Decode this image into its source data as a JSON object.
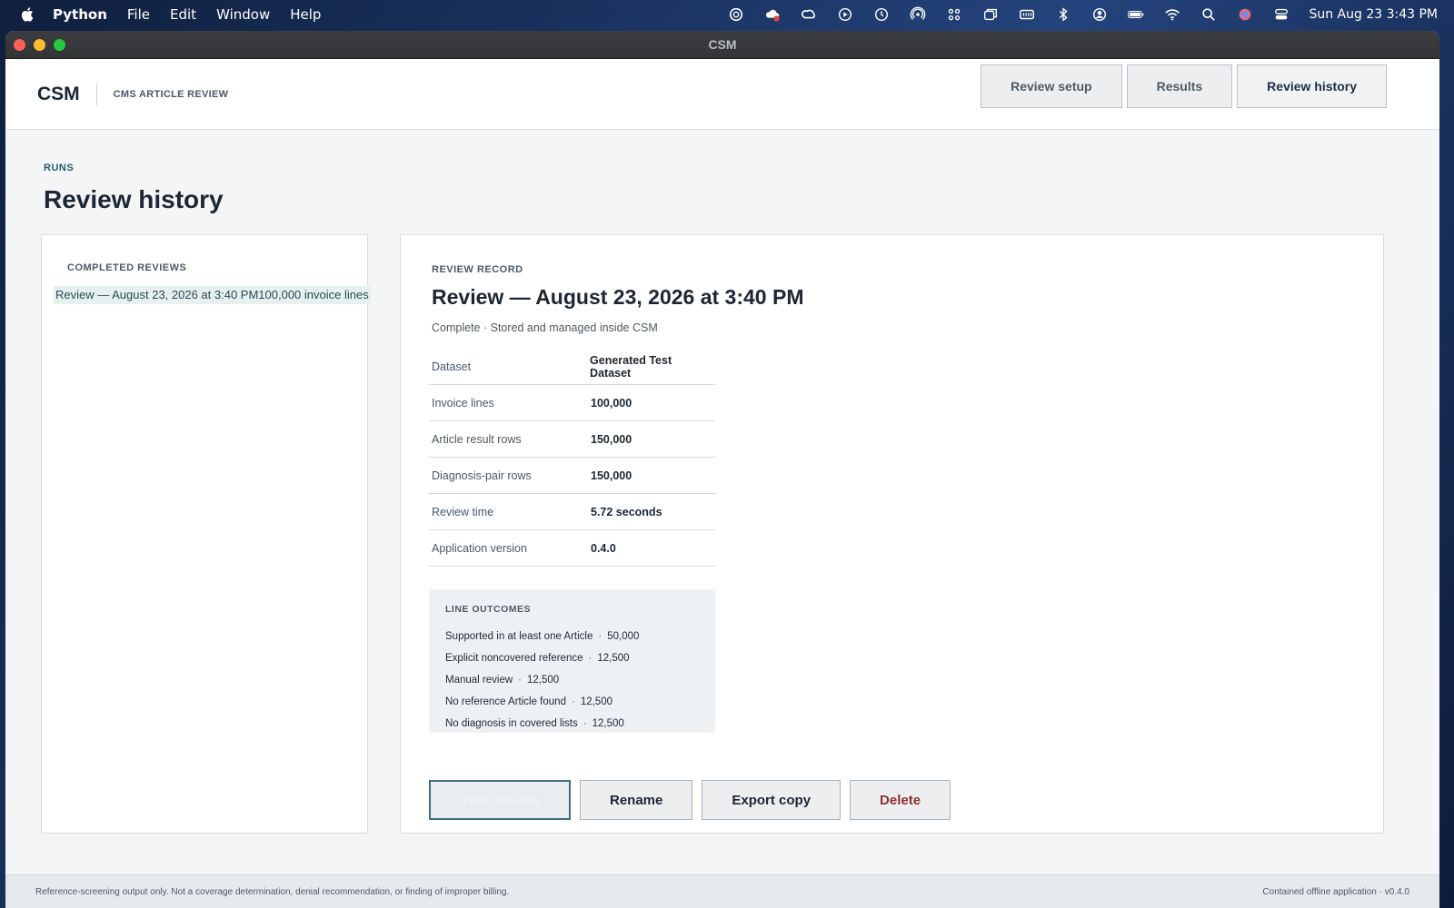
{
  "menubar": {
    "app_name": "Python",
    "items": [
      "File",
      "Edit",
      "Window",
      "Help"
    ],
    "clock": "Sun Aug 23  3:43 PM"
  },
  "window": {
    "title": "CSM"
  },
  "header": {
    "brand": "CSM",
    "subtitle": "CMS ARTICLE REVIEW",
    "nav": [
      {
        "label": "Review setup",
        "active": false
      },
      {
        "label": "Results",
        "active": false
      },
      {
        "label": "Review history",
        "active": true
      }
    ]
  },
  "page": {
    "eyebrow": "RUNS",
    "title": "Review history"
  },
  "sidebar": {
    "heading": "COMPLETED REVIEWS",
    "items": [
      {
        "label": "Review — August 23, 2026 at 3:40 PM100,000 invoice lines",
        "selected": true
      }
    ]
  },
  "record": {
    "eyebrow": "REVIEW RECORD",
    "title": "Review — August 23, 2026 at 3:40 PM",
    "subtitle": "Complete · Stored and managed inside CSM",
    "details": [
      {
        "label": "Dataset",
        "value": "Generated Test Dataset"
      },
      {
        "label": "Invoice lines",
        "value": "100,000"
      },
      {
        "label": "Article result rows",
        "value": "150,000"
      },
      {
        "label": "Diagnosis-pair rows",
        "value": "150,000"
      },
      {
        "label": "Review time",
        "value": "5.72 seconds"
      },
      {
        "label": "Application version",
        "value": "0.4.0"
      }
    ],
    "outcomes_heading": "LINE OUTCOMES",
    "outcomes": [
      {
        "label": "Supported in at least one Article",
        "sep": "·",
        "value": "50,000"
      },
      {
        "label": "Explicit noncovered reference",
        "sep": "·",
        "value": "12,500"
      },
      {
        "label": "Manual review",
        "sep": "·",
        "value": "12,500"
      },
      {
        "label": "No reference Article found",
        "sep": "·",
        "value": "12,500"
      },
      {
        "label": "No diagnosis in covered lists",
        "sep": "·",
        "value": "12,500"
      }
    ],
    "actions": {
      "view_results": "View results",
      "rename": "Rename",
      "export": "Export copy",
      "delete": "Delete"
    }
  },
  "footer": {
    "disclaimer": "Reference-screening output only. Not a coverage determination, denial recommendation, or finding of improper billing.",
    "version_note": "Contained offline application · v0.4.0"
  },
  "colors": {
    "accent": "#275a6d",
    "danger": "#8a3030",
    "selected_bg": "#e6f0ef"
  }
}
